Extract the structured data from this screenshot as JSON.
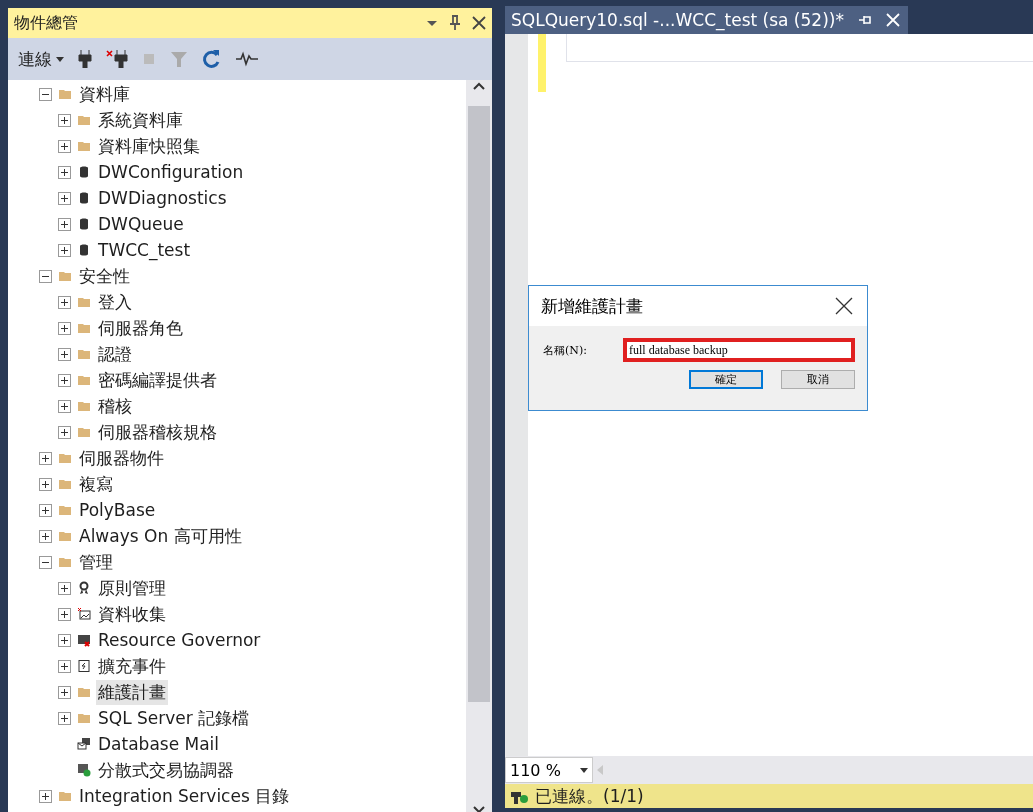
{
  "explorer": {
    "title": "物件總管",
    "toolbar": {
      "connect_label": "連線"
    },
    "tree": [
      {
        "label": "資料庫",
        "kind": "folder",
        "expandable": true,
        "expanded": true,
        "selected": false,
        "children": [
          {
            "label": "系統資料庫",
            "kind": "folder",
            "expandable": true,
            "expanded": false,
            "selected": false
          },
          {
            "label": "資料庫快照集",
            "kind": "folder",
            "expandable": true,
            "expanded": false,
            "selected": false
          },
          {
            "label": "DWConfiguration",
            "kind": "database",
            "expandable": true,
            "expanded": false,
            "selected": false
          },
          {
            "label": "DWDiagnostics",
            "kind": "database",
            "expandable": true,
            "expanded": false,
            "selected": false
          },
          {
            "label": "DWQueue",
            "kind": "database",
            "expandable": true,
            "expanded": false,
            "selected": false
          },
          {
            "label": "TWCC_test",
            "kind": "database",
            "expandable": true,
            "expanded": false,
            "selected": false
          }
        ]
      },
      {
        "label": "安全性",
        "kind": "folder",
        "expandable": true,
        "expanded": true,
        "selected": false,
        "children": [
          {
            "label": "登入",
            "kind": "folder",
            "expandable": true,
            "expanded": false,
            "selected": false
          },
          {
            "label": "伺服器角色",
            "kind": "folder",
            "expandable": true,
            "expanded": false,
            "selected": false
          },
          {
            "label": "認證",
            "kind": "folder",
            "expandable": true,
            "expanded": false,
            "selected": false
          },
          {
            "label": "密碼編譯提供者",
            "kind": "folder",
            "expandable": true,
            "expanded": false,
            "selected": false
          },
          {
            "label": "稽核",
            "kind": "folder",
            "expandable": true,
            "expanded": false,
            "selected": false
          },
          {
            "label": "伺服器稽核規格",
            "kind": "folder",
            "expandable": true,
            "expanded": false,
            "selected": false
          }
        ]
      },
      {
        "label": "伺服器物件",
        "kind": "folder",
        "expandable": true,
        "expanded": false,
        "selected": false
      },
      {
        "label": "複寫",
        "kind": "folder",
        "expandable": true,
        "expanded": false,
        "selected": false
      },
      {
        "label": "PolyBase",
        "kind": "folder",
        "expandable": true,
        "expanded": false,
        "selected": false
      },
      {
        "label": "Always On 高可用性",
        "kind": "folder",
        "expandable": true,
        "expanded": false,
        "selected": false
      },
      {
        "label": "管理",
        "kind": "folder",
        "expandable": true,
        "expanded": true,
        "selected": false,
        "children": [
          {
            "label": "原則管理",
            "kind": "policy",
            "expandable": true,
            "expanded": false,
            "selected": false
          },
          {
            "label": "資料收集",
            "kind": "collection",
            "expandable": true,
            "expanded": false,
            "selected": false
          },
          {
            "label": "Resource Governor",
            "kind": "governor",
            "expandable": true,
            "expanded": false,
            "selected": false
          },
          {
            "label": "擴充事件",
            "kind": "events",
            "expandable": true,
            "expanded": false,
            "selected": false
          },
          {
            "label": "維護計畫",
            "kind": "folder",
            "expandable": true,
            "expanded": false,
            "selected": true
          },
          {
            "label": "SQL Server 記錄檔",
            "kind": "folder",
            "expandable": true,
            "expanded": false,
            "selected": false
          },
          {
            "label": "Database Mail",
            "kind": "mail",
            "expandable": false,
            "expanded": false,
            "selected": false
          },
          {
            "label": "分散式交易協調器",
            "kind": "dtc",
            "expandable": false,
            "expanded": false,
            "selected": false
          }
        ]
      },
      {
        "label": "Integration Services 目錄",
        "kind": "folder",
        "expandable": true,
        "expanded": false,
        "selected": false
      }
    ]
  },
  "editor": {
    "tab": {
      "title": "SQLQuery10.sql -...WCC_test (sa (52))*",
      "selected": true
    },
    "zoom": "110 %",
    "status": "已連線。(1/1)"
  },
  "dialog": {
    "title": "新增維護計畫",
    "name_label": "名稱(N):",
    "name_value": "full database backup",
    "buttons": [
      {
        "label": "確定",
        "focused": true
      },
      {
        "label": "取消",
        "focused": false
      }
    ]
  }
}
